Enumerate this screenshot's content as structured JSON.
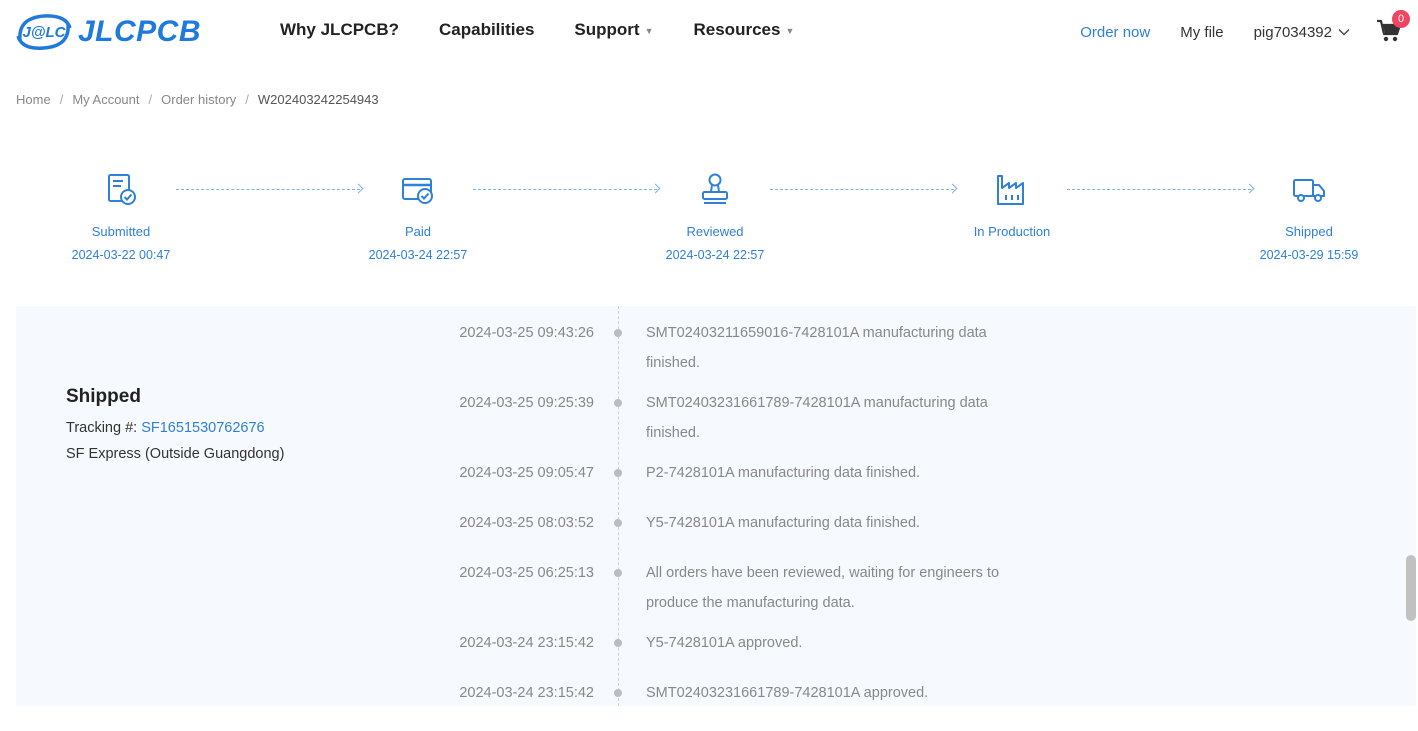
{
  "header": {
    "logo_text": "JLCPCB",
    "logo_badge_text": "J@LC",
    "nav": [
      {
        "label": "Why JLCPCB?",
        "has_caret": false
      },
      {
        "label": "Capabilities",
        "has_caret": false
      },
      {
        "label": "Support",
        "has_caret": true
      },
      {
        "label": "Resources",
        "has_caret": true
      }
    ],
    "order_now": "Order now",
    "my_file": "My file",
    "username": "pig7034392",
    "cart_count": "0"
  },
  "breadcrumb": [
    "Home",
    "My Account",
    "Order history",
    "W202403242254943"
  ],
  "steps": [
    {
      "label": "Submitted",
      "date": "2024-03-22 00:47",
      "icon": "document-check-icon"
    },
    {
      "label": "Paid",
      "date": "2024-03-24 22:57",
      "icon": "card-check-icon"
    },
    {
      "label": "Reviewed",
      "date": "2024-03-24 22:57",
      "icon": "stamp-icon"
    },
    {
      "label": "In Production",
      "date": "",
      "icon": "factory-icon"
    },
    {
      "label": "Shipped",
      "date": "2024-03-29 15:59",
      "icon": "truck-icon"
    }
  ],
  "shipment": {
    "title": "Shipped",
    "tracking_label": "Tracking #:",
    "tracking_number": "SF1651530762676",
    "carrier": "SF Express (Outside Guangdong)"
  },
  "events": [
    {
      "time": "2024-03-25 09:43:26",
      "desc": "SMT02403211659016-7428101A manufacturing data finished."
    },
    {
      "time": "2024-03-25 09:25:39",
      "desc": "SMT02403231661789-7428101A manufacturing data finished."
    },
    {
      "time": "2024-03-25 09:05:47",
      "desc": "P2-7428101A manufacturing data finished."
    },
    {
      "time": "2024-03-25 08:03:52",
      "desc": "Y5-7428101A manufacturing data finished."
    },
    {
      "time": "2024-03-25 06:25:13",
      "desc": "All orders have been reviewed, waiting for engineers to produce the manufacturing data."
    },
    {
      "time": "2024-03-24 23:15:42",
      "desc": "Y5-7428101A approved."
    },
    {
      "time": "2024-03-24 23:15:42",
      "desc": "SMT02403231661789-7428101A approved."
    }
  ],
  "colors": {
    "brand": "#1f7bdb",
    "link": "#2f80d9",
    "badge": "#f04560",
    "panel_bg": "#f6f9fd"
  }
}
